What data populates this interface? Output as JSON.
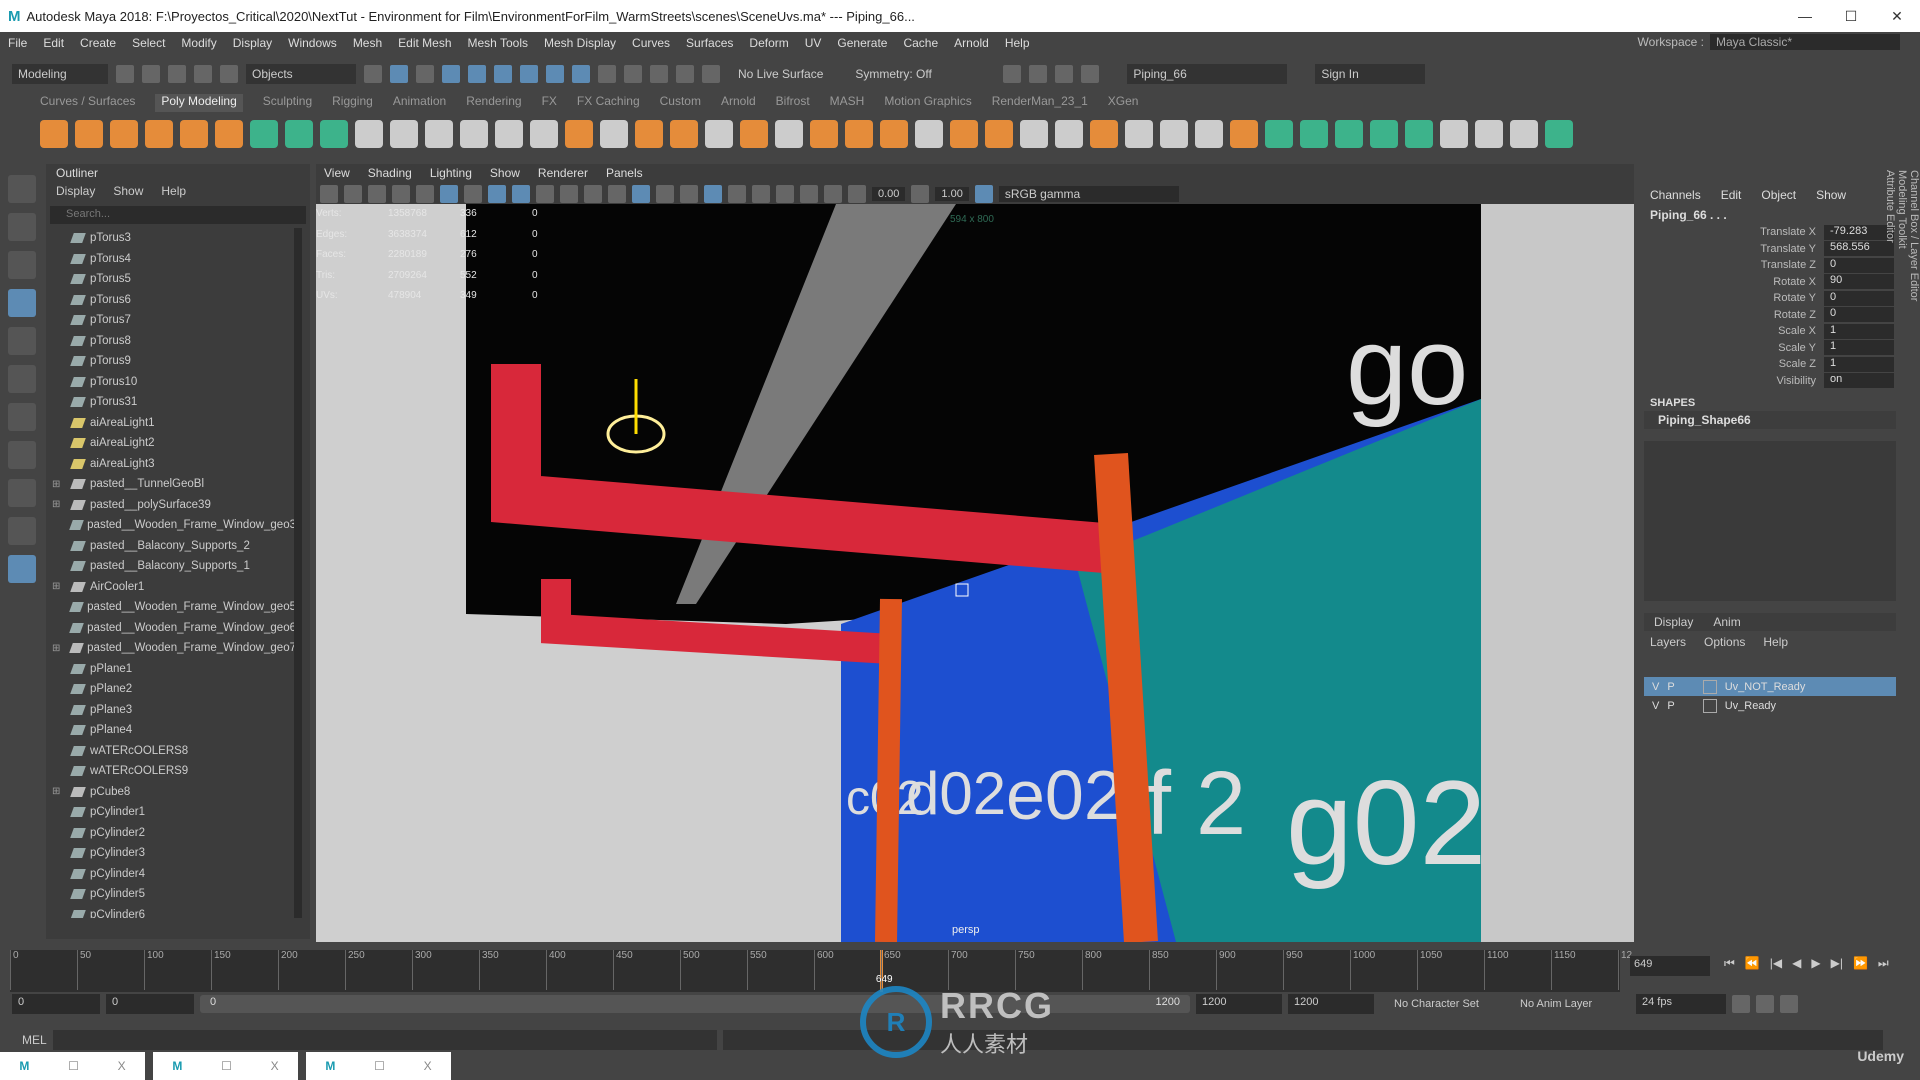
{
  "window": {
    "title": "Autodesk Maya 2018: F:\\Proyectos_Critical\\2020\\NextTut - Environment for Film\\EnvironmentForFilm_WarmStreets\\scenes\\SceneUvs.ma*   ---   Piping_66...",
    "logo": "M",
    "minimize": "—",
    "maximize": "☐",
    "close": "✕"
  },
  "menubar": [
    "File",
    "Edit",
    "Create",
    "Select",
    "Modify",
    "Display",
    "Windows",
    "Mesh",
    "Edit Mesh",
    "Mesh Tools",
    "Mesh Display",
    "Curves",
    "Surfaces",
    "Deform",
    "UV",
    "Generate",
    "Cache",
    "Arnold",
    "Help"
  ],
  "workspace": {
    "label": "Workspace :",
    "value": "Maya Classic*"
  },
  "statusline": {
    "menuset": "Modeling",
    "selmode": "Objects",
    "live_surface": "No Live Surface",
    "symmetry": "Symmetry: Off",
    "name_field": "Piping_66",
    "sign_in": "Sign In"
  },
  "shelf": {
    "tabs": [
      "Curves / Surfaces",
      "Poly Modeling",
      "Sculpting",
      "Rigging",
      "Animation",
      "Rendering",
      "FX",
      "FX Caching",
      "Custom",
      "Arnold",
      "Bifrost",
      "MASH",
      "Motion Graphics",
      "RenderMan_23_1",
      "XGen"
    ],
    "active": "Poly Modeling"
  },
  "outliner": {
    "title": "Outliner",
    "menu": [
      "Display",
      "Show",
      "Help"
    ],
    "search_placeholder": "Search...",
    "items": [
      {
        "name": "pTorus3",
        "type": "mesh"
      },
      {
        "name": "pTorus4",
        "type": "mesh"
      },
      {
        "name": "pTorus5",
        "type": "mesh"
      },
      {
        "name": "pTorus6",
        "type": "mesh"
      },
      {
        "name": "pTorus7",
        "type": "mesh"
      },
      {
        "name": "pTorus8",
        "type": "mesh"
      },
      {
        "name": "pTorus9",
        "type": "mesh"
      },
      {
        "name": "pTorus10",
        "type": "mesh"
      },
      {
        "name": "pTorus31",
        "type": "mesh"
      },
      {
        "name": "aiAreaLight1",
        "type": "light"
      },
      {
        "name": "aiAreaLight2",
        "type": "light"
      },
      {
        "name": "aiAreaLight3",
        "type": "light"
      },
      {
        "name": "pasted__TunnelGeoBl",
        "type": "group",
        "expandable": true
      },
      {
        "name": "pasted__polySurface39",
        "type": "group",
        "expandable": true
      },
      {
        "name": "pasted__Wooden_Frame_Window_geo3",
        "type": "mesh"
      },
      {
        "name": "pasted__Balacony_Supports_2",
        "type": "mesh"
      },
      {
        "name": "pasted__Balacony_Supports_1",
        "type": "mesh"
      },
      {
        "name": "AirCooler1",
        "type": "group",
        "expandable": true
      },
      {
        "name": "pasted__Wooden_Frame_Window_geo5",
        "type": "mesh"
      },
      {
        "name": "pasted__Wooden_Frame_Window_geo6",
        "type": "mesh"
      },
      {
        "name": "pasted__Wooden_Frame_Window_geo7",
        "type": "group",
        "expandable": true
      },
      {
        "name": "pPlane1",
        "type": "mesh"
      },
      {
        "name": "pPlane2",
        "type": "mesh"
      },
      {
        "name": "pPlane3",
        "type": "mesh"
      },
      {
        "name": "pPlane4",
        "type": "mesh"
      },
      {
        "name": "wATERcOOLERS8",
        "type": "mesh"
      },
      {
        "name": "wATERcOOLERS9",
        "type": "mesh"
      },
      {
        "name": "pCube8",
        "type": "group",
        "expandable": true
      },
      {
        "name": "pCylinder1",
        "type": "mesh"
      },
      {
        "name": "pCylinder2",
        "type": "mesh"
      },
      {
        "name": "pCylinder3",
        "type": "mesh"
      },
      {
        "name": "pCylinder4",
        "type": "mesh"
      },
      {
        "name": "pCylinder5",
        "type": "mesh"
      },
      {
        "name": "pCylinder6",
        "type": "mesh"
      }
    ]
  },
  "viewport": {
    "menu": [
      "View",
      "Shading",
      "Lighting",
      "Show",
      "Renderer",
      "Panels"
    ],
    "exposure": "0.00",
    "gamma": "1.00",
    "color_space": "sRGB gamma",
    "camera": "persp",
    "resolution": "594 x 800",
    "hud": [
      [
        "Verts:",
        "1358768",
        "336",
        "0"
      ],
      [
        "Edges:",
        "3638374",
        "612",
        "0"
      ],
      [
        "Faces:",
        "2280189",
        "276",
        "0"
      ],
      [
        "Tris:",
        "2709264",
        "552",
        "0"
      ],
      [
        "UVs:",
        "478904",
        "349",
        "0"
      ]
    ],
    "wall_labels": [
      "c02",
      "d02",
      "e02",
      "f 2",
      "g02",
      "go"
    ]
  },
  "channelbox": {
    "menu": [
      "Channels",
      "Edit",
      "Object",
      "Show"
    ],
    "object": "Piping_66 . . .",
    "attrs": [
      [
        "Translate X",
        "-79.283"
      ],
      [
        "Translate Y",
        "568.556"
      ],
      [
        "Translate Z",
        "0"
      ],
      [
        "Rotate X",
        "90"
      ],
      [
        "Rotate Y",
        "0"
      ],
      [
        "Rotate Z",
        "0"
      ],
      [
        "Scale X",
        "1"
      ],
      [
        "Scale Y",
        "1"
      ],
      [
        "Scale Z",
        "1"
      ],
      [
        "Visibility",
        "on"
      ]
    ],
    "shapes_label": "SHAPES",
    "shape": "Piping_Shape66",
    "layer_tabs": [
      "Display",
      "Anim"
    ],
    "layer_menu": [
      "Layers",
      "Options",
      "Help"
    ],
    "layers": [
      {
        "v": "V",
        "p": "P",
        "name": "Uv_NOT_Ready",
        "selected": true
      },
      {
        "v": "V",
        "p": "P",
        "name": "Uv_Ready",
        "selected": false
      }
    ]
  },
  "side_tabs": [
    "Channel Box / Layer Editor",
    "Modeling Toolkit",
    "Attribute Editor"
  ],
  "timeline": {
    "ticks": [
      "0",
      "50",
      "100",
      "150",
      "200",
      "250",
      "300",
      "350",
      "400",
      "450",
      "500",
      "550",
      "600",
      "650",
      "700",
      "750",
      "800",
      "850",
      "900",
      "950",
      "1000",
      "1050",
      "1100",
      "1150",
      "12"
    ],
    "current_frame": "649",
    "frame_field": "649",
    "current_fraction": 0.541
  },
  "range": {
    "start": "0",
    "anim_start": "0",
    "slider_start": "0",
    "slider_end": "1200",
    "anim_end": "1200",
    "end": "1200",
    "character_set": "No Character Set",
    "anim_layer": "No Anim Layer",
    "fps": "24 fps"
  },
  "playback": [
    "⏮",
    "⏪",
    "|◀",
    "◀",
    "▶",
    "▶|",
    "⏩",
    "⏭"
  ],
  "mel": {
    "label": "MEL"
  },
  "taskbar": [
    {
      "icon": "M",
      "close": "X"
    },
    {
      "icon": "M",
      "close": "X"
    },
    {
      "icon": "M",
      "close": "X"
    }
  ],
  "watermark": {
    "brand": "RRCG",
    "sub": "人人素材",
    "udemy": "Udemy"
  },
  "colors": {
    "accent": "#5d8bb4",
    "shelf_icon": "#e58c3a",
    "pipe_red": "#d8283a",
    "pipe_orange": "#e0541e",
    "wall_blue": "#1d4fd0",
    "wall_teal": "#138a8c"
  }
}
